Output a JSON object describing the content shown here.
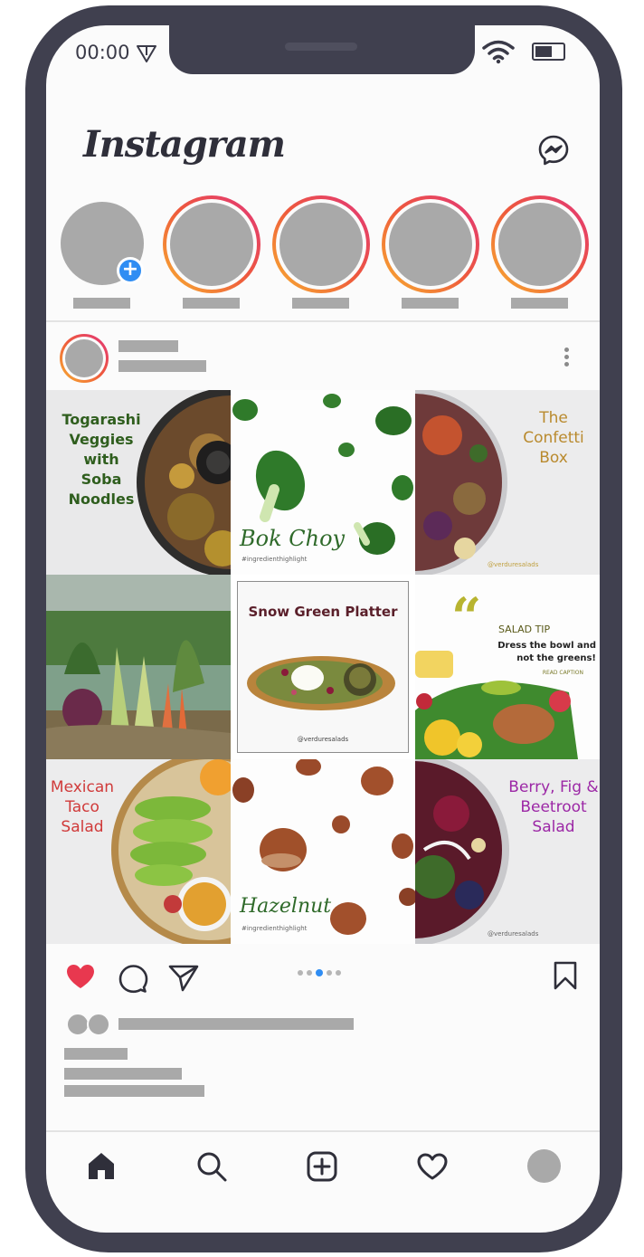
{
  "status_bar": {
    "time": "00:00",
    "icons": [
      "navigation-arrow-icon",
      "wifi-icon",
      "battery-icon"
    ]
  },
  "header": {
    "app_title": "Instagram",
    "icons": [
      "messenger-icon"
    ]
  },
  "stories": {
    "count": 5,
    "own_story_badge": "+",
    "colors": {
      "ring_start": "#f8b030",
      "ring_mid": "#ee5a3c",
      "ring_end": "#e2357a",
      "placeholder": "#a9a9a9",
      "badge": "#2f8df3"
    }
  },
  "post": {
    "grid_tiles": [
      {
        "title_lines": [
          "Togarashi",
          "Veggies",
          "with",
          "Soba",
          "Noodles"
        ]
      },
      {
        "script": "Bok Choy",
        "hashtag": "#ingredienthighlight"
      },
      {
        "title_lines": [
          "The",
          "Confetti",
          "Box"
        ],
        "handle": "@verduresalads"
      },
      {
        "image": "fresh-vegetables-photo"
      },
      {
        "title": "Snow Green Platter",
        "handle": "@verduresalads"
      },
      {
        "quote_mark": "“",
        "label": "SALAD TIP",
        "lines": [
          "Dress the bowl and",
          "not the greens!"
        ],
        "sub": "READ CAPTION"
      },
      {
        "title_lines": [
          "Mexican",
          "Taco",
          "Salad"
        ]
      },
      {
        "script": "Hazelnut",
        "hashtag": "#ingredienthighlight"
      },
      {
        "title_lines": [
          "Berry, Fig &",
          "Beetroot",
          "Salad"
        ],
        "handle": "@verduresalads"
      }
    ],
    "carousel": {
      "total": 5,
      "active_index": 2
    },
    "actions": [
      "heart-icon",
      "comment-icon",
      "share-icon",
      "bookmark-icon"
    ],
    "colors": {
      "like": "#e8384f",
      "green_title": "#2f5e1e",
      "gold_title": "#b98a2e",
      "red_title": "#d03a3a",
      "purple_title": "#9c28a6"
    }
  },
  "bottom_nav": {
    "items": [
      "home-icon",
      "search-icon",
      "new-post-icon",
      "activity-icon",
      "profile-avatar"
    ]
  }
}
